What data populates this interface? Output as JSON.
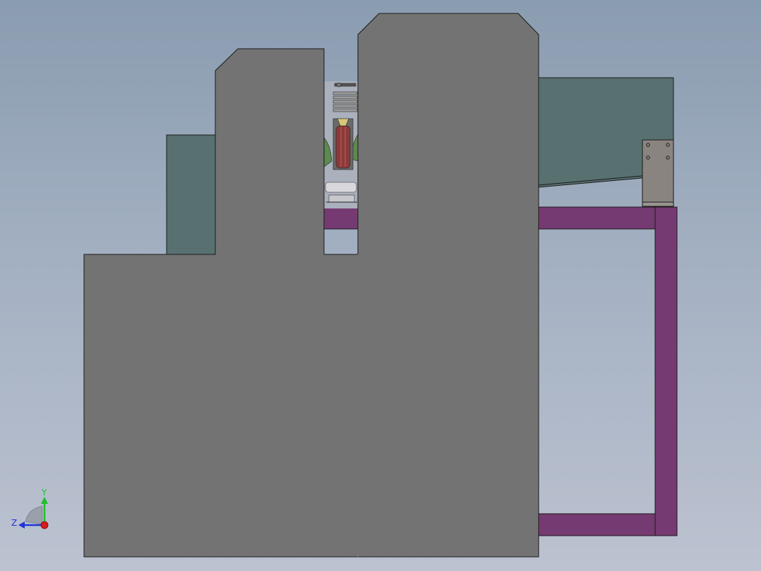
{
  "viewport": {
    "background_top": "#8a9cb0",
    "background_bottom": "#bcc2d0"
  },
  "colors": {
    "housing_gray": "#737373",
    "panel_teal": "#587070",
    "frame_purple": "#763a72",
    "bracket_gray": "#8a8480",
    "motor_green": "#5d8a4e",
    "pulley_red": "#8b3a3a",
    "edge_black": "#1a1a1a"
  },
  "triad": {
    "y_label": "Y",
    "z_label": "Z",
    "y_color": "#1fbf2a",
    "z_color": "#2136d6",
    "x_color": "#d61c1c"
  }
}
